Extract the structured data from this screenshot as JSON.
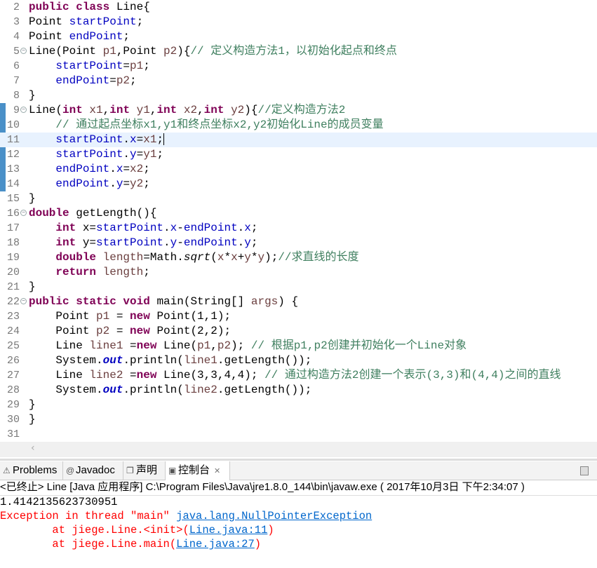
{
  "editor": {
    "current_line": 11,
    "fold_lines": [
      5,
      9,
      16,
      22
    ],
    "changed_lines": [
      9,
      10,
      11,
      12,
      13,
      14
    ],
    "lines": [
      {
        "n": "2",
        "t": [
          [
            "k",
            "public class "
          ],
          [
            "n",
            "Line{"
          ]
        ]
      },
      {
        "n": "3",
        "t": [
          [
            "n",
            "Point "
          ],
          [
            "f",
            "startPoint"
          ],
          [
            "n",
            ";"
          ]
        ]
      },
      {
        "n": "4",
        "t": [
          [
            "n",
            "Point "
          ],
          [
            "f",
            "endPoint"
          ],
          [
            "n",
            ";"
          ]
        ]
      },
      {
        "n": "5",
        "t": [
          [
            "n",
            "Line(Point "
          ],
          [
            "p",
            "p1"
          ],
          [
            "n",
            ",Point "
          ],
          [
            "p",
            "p2"
          ],
          [
            "n",
            "){"
          ],
          [
            "c",
            "// 定义构造方法1，以初始化起点和终点"
          ]
        ]
      },
      {
        "n": "6",
        "t": [
          [
            "n",
            "    "
          ],
          [
            "f",
            "startPoint"
          ],
          [
            "n",
            "="
          ],
          [
            "p",
            "p1"
          ],
          [
            "n",
            ";"
          ]
        ]
      },
      {
        "n": "7",
        "t": [
          [
            "n",
            "    "
          ],
          [
            "f",
            "endPoint"
          ],
          [
            "n",
            "="
          ],
          [
            "p",
            "p2"
          ],
          [
            "n",
            ";"
          ]
        ]
      },
      {
        "n": "8",
        "t": [
          [
            "n",
            "}"
          ]
        ]
      },
      {
        "n": "9",
        "t": [
          [
            "n",
            "Line("
          ],
          [
            "k",
            "int "
          ],
          [
            "p",
            "x1"
          ],
          [
            "n",
            ","
          ],
          [
            "k",
            "int "
          ],
          [
            "p",
            "y1"
          ],
          [
            "n",
            ","
          ],
          [
            "k",
            "int "
          ],
          [
            "p",
            "x2"
          ],
          [
            "n",
            ","
          ],
          [
            "k",
            "int "
          ],
          [
            "p",
            "y2"
          ],
          [
            "n",
            "){"
          ],
          [
            "c",
            "//定义构造方法2"
          ]
        ]
      },
      {
        "n": "10",
        "t": [
          [
            "c",
            "    // 通过起点坐标x1,y1和终点坐标x2,y2初始化Line的成员变量"
          ]
        ]
      },
      {
        "n": "11",
        "t": [
          [
            "n",
            "    "
          ],
          [
            "f",
            "startPoint"
          ],
          [
            "n",
            "."
          ],
          [
            "f",
            "x"
          ],
          [
            "n",
            "="
          ],
          [
            "p",
            "x1"
          ],
          [
            "n",
            ";"
          ]
        ]
      },
      {
        "n": "12",
        "t": [
          [
            "n",
            "    "
          ],
          [
            "f",
            "startPoint"
          ],
          [
            "n",
            "."
          ],
          [
            "f",
            "y"
          ],
          [
            "n",
            "="
          ],
          [
            "p",
            "y1"
          ],
          [
            "n",
            ";"
          ]
        ]
      },
      {
        "n": "13",
        "t": [
          [
            "n",
            "    "
          ],
          [
            "f",
            "endPoint"
          ],
          [
            "n",
            "."
          ],
          [
            "f",
            "x"
          ],
          [
            "n",
            "="
          ],
          [
            "p",
            "x2"
          ],
          [
            "n",
            ";"
          ]
        ]
      },
      {
        "n": "14",
        "t": [
          [
            "n",
            "    "
          ],
          [
            "f",
            "endPoint"
          ],
          [
            "n",
            "."
          ],
          [
            "f",
            "y"
          ],
          [
            "n",
            "="
          ],
          [
            "p",
            "y2"
          ],
          [
            "n",
            ";"
          ]
        ]
      },
      {
        "n": "15",
        "t": [
          [
            "n",
            "}"
          ]
        ]
      },
      {
        "n": "16",
        "t": [
          [
            "k",
            "double "
          ],
          [
            "n",
            "getLength(){"
          ]
        ]
      },
      {
        "n": "17",
        "t": [
          [
            "n",
            "    "
          ],
          [
            "k",
            "int "
          ],
          [
            "n",
            "x="
          ],
          [
            "f",
            "startPoint"
          ],
          [
            "n",
            "."
          ],
          [
            "f",
            "x"
          ],
          [
            "n",
            "-"
          ],
          [
            "f",
            "endPoint"
          ],
          [
            "n",
            "."
          ],
          [
            "f",
            "x"
          ],
          [
            "n",
            ";"
          ]
        ]
      },
      {
        "n": "18",
        "t": [
          [
            "n",
            "    "
          ],
          [
            "k",
            "int "
          ],
          [
            "n",
            "y="
          ],
          [
            "f",
            "startPoint"
          ],
          [
            "n",
            "."
          ],
          [
            "f",
            "y"
          ],
          [
            "n",
            "-"
          ],
          [
            "f",
            "endPoint"
          ],
          [
            "n",
            "."
          ],
          [
            "f",
            "y"
          ],
          [
            "n",
            ";"
          ]
        ]
      },
      {
        "n": "19",
        "t": [
          [
            "n",
            "    "
          ],
          [
            "k",
            "double "
          ],
          [
            "p",
            "length"
          ],
          [
            "n",
            "=Math."
          ],
          [
            "mi",
            "sqrt"
          ],
          [
            "n",
            "("
          ],
          [
            "p",
            "x"
          ],
          [
            "n",
            "*"
          ],
          [
            "p",
            "x"
          ],
          [
            "n",
            "+"
          ],
          [
            "p",
            "y"
          ],
          [
            "n",
            "*"
          ],
          [
            "p",
            "y"
          ],
          [
            "n",
            ");"
          ],
          [
            "c",
            "//求直线的长度"
          ]
        ]
      },
      {
        "n": "20",
        "t": [
          [
            "n",
            "    "
          ],
          [
            "k",
            "return "
          ],
          [
            "p",
            "length"
          ],
          [
            "n",
            ";"
          ]
        ]
      },
      {
        "n": "21",
        "t": [
          [
            "n",
            "}"
          ]
        ]
      },
      {
        "n": "22",
        "t": [
          [
            "k",
            "public static void "
          ],
          [
            "n",
            "main(String[] "
          ],
          [
            "p",
            "args"
          ],
          [
            "n",
            ") {"
          ]
        ]
      },
      {
        "n": "23",
        "t": [
          [
            "n",
            "    Point "
          ],
          [
            "p",
            "p1"
          ],
          [
            "n",
            " = "
          ],
          [
            "k",
            "new "
          ],
          [
            "n",
            "Point(1,1);"
          ]
        ]
      },
      {
        "n": "24",
        "t": [
          [
            "n",
            "    Point "
          ],
          [
            "p",
            "p2"
          ],
          [
            "n",
            " = "
          ],
          [
            "k",
            "new "
          ],
          [
            "n",
            "Point(2,2);"
          ]
        ]
      },
      {
        "n": "25",
        "t": [
          [
            "n",
            "    Line "
          ],
          [
            "p",
            "line1"
          ],
          [
            "n",
            " ="
          ],
          [
            "k",
            "new "
          ],
          [
            "n",
            "Line("
          ],
          [
            "p",
            "p1"
          ],
          [
            "n",
            ","
          ],
          [
            "p",
            "p2"
          ],
          [
            "n",
            "); "
          ],
          [
            "c",
            "// 根据p1,p2创建并初始化一个Line对象"
          ]
        ]
      },
      {
        "n": "26",
        "t": [
          [
            "n",
            "    System."
          ],
          [
            "fi",
            "out"
          ],
          [
            "n",
            ".println("
          ],
          [
            "p",
            "line1"
          ],
          [
            "n",
            ".getLength());"
          ]
        ]
      },
      {
        "n": "27",
        "t": [
          [
            "n",
            "    Line "
          ],
          [
            "p",
            "line2"
          ],
          [
            "n",
            " ="
          ],
          [
            "k",
            "new "
          ],
          [
            "n",
            "Line(3,3,4,4); "
          ],
          [
            "c",
            "// 通过构造方法2创建一个表示(3,3)和(4,4)之间的直线"
          ]
        ]
      },
      {
        "n": "28",
        "t": [
          [
            "n",
            "    System."
          ],
          [
            "fi",
            "out"
          ],
          [
            "n",
            ".println("
          ],
          [
            "p",
            "line2"
          ],
          [
            "n",
            ".getLength());"
          ]
        ]
      },
      {
        "n": "29",
        "t": [
          [
            "n",
            "}"
          ]
        ]
      },
      {
        "n": "30",
        "t": [
          [
            "n",
            "}"
          ]
        ]
      },
      {
        "n": "31",
        "t": []
      }
    ]
  },
  "tabs": [
    {
      "label": "Problems",
      "icon": "problems-icon",
      "glyph": "⚠"
    },
    {
      "label": "Javadoc",
      "icon": "javadoc-icon",
      "glyph": "@"
    },
    {
      "label": "声明",
      "icon": "declaration-icon",
      "glyph": "❐"
    },
    {
      "label": "控制台",
      "icon": "console-icon",
      "glyph": "▣",
      "active": true
    }
  ],
  "console": {
    "header": "<已终止> Line [Java 应用程序] C:\\Program Files\\Java\\jre1.8.0_144\\bin\\javaw.exe ( 2017年10月3日 下午2:34:07 )",
    "output": "1.4142135623730951",
    "exception_prefix": "Exception in thread \"main\" ",
    "exception_link": "java.lang.NullPointerException",
    "trace": [
      {
        "prefix": "        at jiege.Line.<init>(",
        "link": "Line.java:11",
        "suffix": ")"
      },
      {
        "prefix": "        at jiege.Line.main(",
        "link": "Line.java:27",
        "suffix": ")"
      }
    ]
  }
}
